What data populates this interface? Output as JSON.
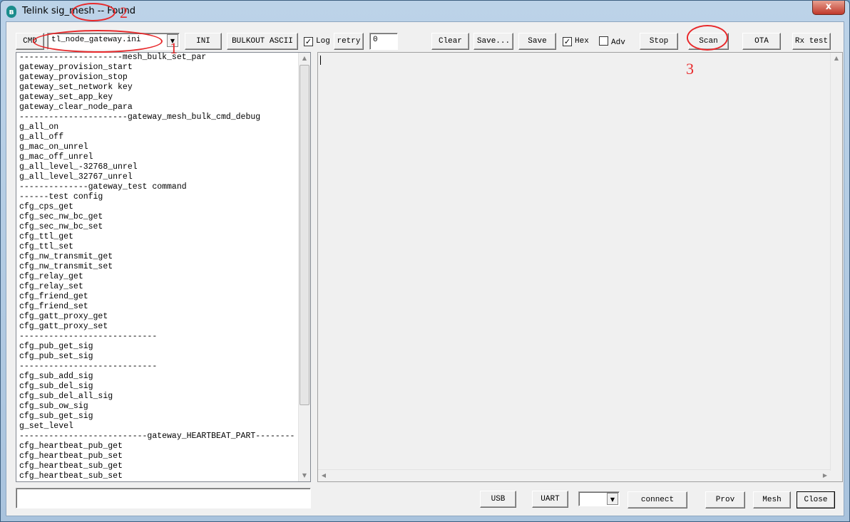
{
  "window": {
    "title": "Telink sig_mesh -- Found",
    "app_icon": "bluetooth-icon",
    "close_label": "x"
  },
  "toolbar": {
    "cmd_label": "CMD",
    "ini_file": "tl_node_gateway.ini",
    "ini_label": "INI",
    "bulkout_label": "BULKOUT ASCII",
    "log_label": "Log",
    "log_checked": true,
    "retry_label": "retry",
    "retry_value": "0",
    "clear_label": "Clear",
    "save_as_label": "Save...",
    "save_label": "Save",
    "hex_label": "Hex",
    "hex_checked": true,
    "adv_label": "Adv",
    "adv_checked": false,
    "stop_label": "Stop",
    "scan_label": "Scan",
    "ota_label": "OTA",
    "rx_test_label": "Rx test"
  },
  "command_list": [
    "---------------------mesh_bulk_set_par",
    "gateway_provision_start",
    "gateway_provision_stop",
    "gateway_set_network key",
    "gateway_set_app_key",
    "gateway_clear_node_para",
    "----------------------gateway_mesh_bulk_cmd_debug",
    "g_all_on",
    "g_all_off",
    "g_mac_on_unrel",
    "g_mac_off_unrel",
    "g_all_level_-32768_unrel",
    "g_all_level_32767_unrel",
    "--------------gateway_test command",
    "------test config",
    "cfg_cps_get",
    "cfg_sec_nw_bc_get",
    "cfg_sec_nw_bc_set",
    "cfg_ttl_get",
    "cfg_ttl_set",
    "cfg_nw_transmit_get",
    "cfg_nw_transmit_set",
    "cfg_relay_get",
    "cfg_relay_set",
    "cfg_friend_get",
    "cfg_friend_set",
    "cfg_gatt_proxy_get",
    "cfg_gatt_proxy_set",
    "----------------------------",
    "cfg_pub_get_sig",
    "cfg_pub_set_sig",
    "----------------------------",
    "cfg_sub_add_sig",
    "cfg_sub_del_sig",
    "cfg_sub_del_all_sig",
    "cfg_sub_ow_sig",
    "cfg_sub_get_sig",
    "g_set_level",
    "--------------------------gateway_HEARTBEAT_PART--------",
    "cfg_heartbeat_pub_get",
    "cfg_heartbeat_pub_set",
    "cfg_heartbeat_sub_get",
    "cfg_heartbeat_sub_set"
  ],
  "output_text": "",
  "command_input": "",
  "bottom": {
    "usb_label": "USB",
    "uart_label": "UART",
    "port_value": "",
    "connect_label": "connect",
    "prov_label": "Prov",
    "mesh_label": "Mesh",
    "close_label": "Close"
  },
  "annotations": {
    "color": "#e8282a",
    "labels": [
      "1",
      "2",
      "3"
    ]
  }
}
